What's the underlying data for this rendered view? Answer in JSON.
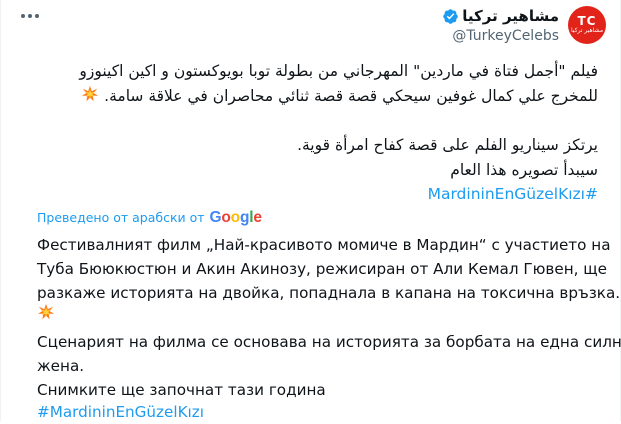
{
  "author": {
    "display_name": "مشاهير تركيا",
    "handle": "@TurkeyCelebs",
    "avatar_text": "TC",
    "avatar_subtext": "مشاهير تركيا"
  },
  "original": {
    "line1": "فيلم \"أجمل فتاة في ماردين\" المهرجاني من بطولة توبا بويوكستون و اكين اكينوزو",
    "line2": "للمخرج علي كمال غوفين سيحكي قصة قصة ثنائي محاصران في علاقة سامة.",
    "line3": "يرتكز سيناريو الفلم على قصة كفاح امرأة قوية.",
    "line4": "سيبدأ تصويره هذا العام",
    "hashtag": "#MardininEnGüzelKızı"
  },
  "translation": {
    "label": "Преведено от арабски от",
    "provider": "Google",
    "line1": "Фестивалният филм „Най-красивото момиче в Мардин“ с участието на",
    "line2": "Туба Бююкюстюн и Акин Акинозу, режисиран от Али Кемал Гювен, ще",
    "line3": "разкаже историята на двойка, попаднала в капана на токсична връзка.",
    "line4": "Сценарият на филма се основава на историята за борбата на една силна",
    "line5": "жена.",
    "line6": "Снимките ще започнат тази година",
    "hashtag": "#MardininEnGüzelKızı"
  },
  "colors": {
    "link": "#1d9bf0",
    "text": "#0f1419",
    "muted": "#536471",
    "avatar_bg": "#e2231a"
  },
  "icons": [
    "more-icon",
    "verified-badge-icon",
    "collision-emoji-icon",
    "google-logo"
  ]
}
